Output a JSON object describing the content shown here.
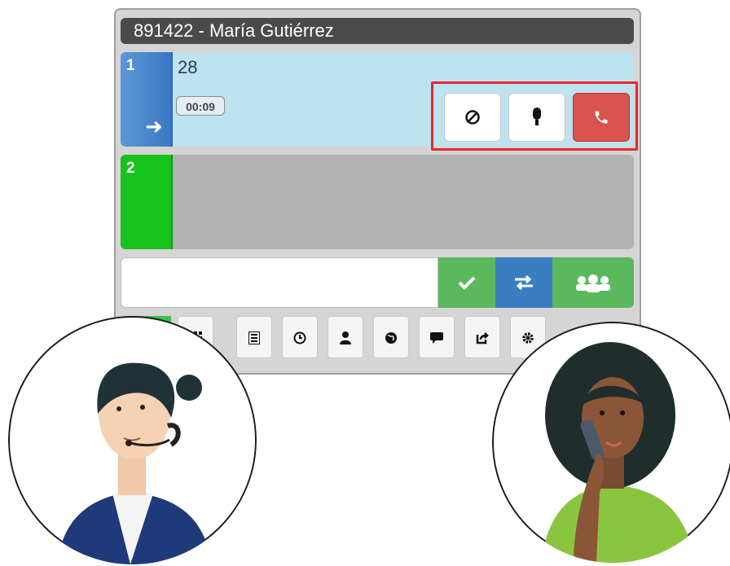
{
  "header": {
    "title": "891422 - María Gutiérrez"
  },
  "line1": {
    "index": "1",
    "number": "28",
    "timer": "00:09"
  },
  "line2": {
    "index": "2"
  },
  "actions": {
    "icons": [
      "block-icon",
      "microphone-icon",
      "phone-hangup-icon"
    ],
    "colors": {
      "hangup": "#d9534f"
    }
  },
  "dial": {
    "placeholder": "",
    "buttons": [
      "check-icon",
      "transfer-icon",
      "conference-icon"
    ],
    "colors": {
      "green": "#5cb85c",
      "blue": "#3a7ec2"
    }
  },
  "toolbar": {
    "icons": [
      "dialpad-icon",
      "list-icon",
      "clock-icon",
      "contact-icon",
      "globe-icon",
      "chat-icon",
      "share-icon",
      "gear-icon"
    ]
  },
  "colors": {
    "line1_active": "#3a78c4",
    "line2_idle": "#17c21d",
    "highlight": "#e8262c"
  }
}
